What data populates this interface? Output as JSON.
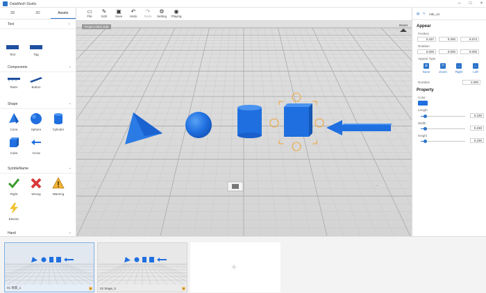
{
  "window": {
    "title": "DataMesh Studio"
  },
  "left_panel": {
    "tabs": [
      "3D",
      "2D",
      "Assets"
    ],
    "sections": {
      "text": {
        "title": "Text",
        "items": [
          "Text",
          "Tag"
        ]
      },
      "components": {
        "title": "Components",
        "items": [
          "Ruler",
          "Button"
        ]
      },
      "shape": {
        "title": "Shape",
        "items": [
          "Cone",
          "Sphere",
          "Cylinder",
          "Cube",
          "Arrow"
        ]
      },
      "symbol": {
        "title": "SymbleName",
        "items": [
          "Right",
          "Wrong",
          "Warning",
          "Electric"
        ]
      },
      "hand": {
        "title": "Hand"
      }
    }
  },
  "toolbar": {
    "file": "File",
    "edit": "Edit",
    "save": "Save",
    "undo": "Undo",
    "redo": "Redo",
    "setting": "Setting",
    "playing": "Playing"
  },
  "viewport": {
    "project_label": "Project 0001 Edit",
    "reset": "Reset"
  },
  "right_panel": {
    "object_name": "role_14",
    "appear_title": "Appear",
    "position_label": "Position",
    "position": [
      "0.437",
      "0.300",
      "0.673"
    ],
    "rotation_label": "Rotation",
    "rotation": [
      "0.000",
      "0.000",
      "0.000"
    ],
    "appear_type_label": "Appear Type",
    "appear_types": [
      "None",
      "Zoom",
      "Right",
      "Left"
    ],
    "duration_label": "Duration",
    "duration": "1.000",
    "property_title": "Property",
    "color_label": "Color",
    "color": "#1f6fe0",
    "length_label": "Length",
    "length": "0.230",
    "width_label": "Width",
    "width": "0.230",
    "height_label": "Height",
    "height": "0.230",
    "slider_fraction": 0.1
  },
  "slides": [
    {
      "label": "01 场景_1"
    },
    {
      "label": "02 Stage_0"
    }
  ],
  "colors": {
    "accent": "#2b73c9",
    "shape_blue": "#1f6fe0",
    "selection": "#f0a63c"
  }
}
